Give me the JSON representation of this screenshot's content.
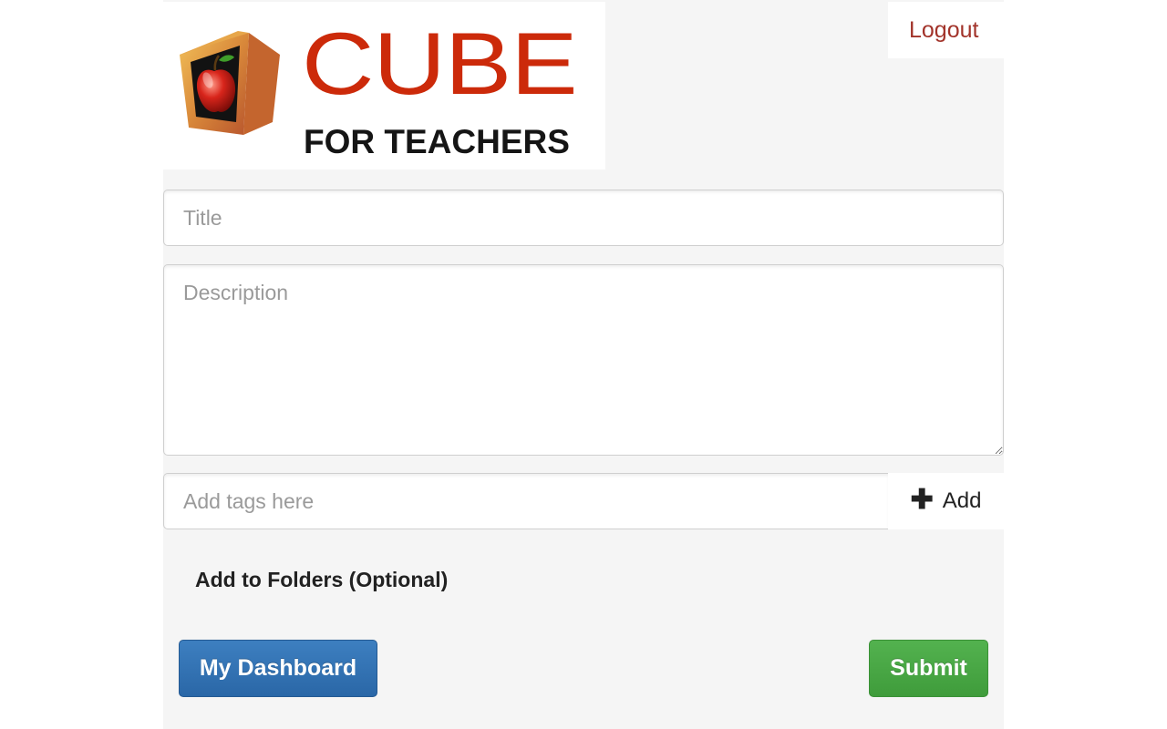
{
  "header": {
    "logo": {
      "word": "CUBE",
      "tagline": "FOR TEACHERS",
      "icon": "apple-cube-icon",
      "word_color": "#cc2a0a"
    },
    "logout_label": "Logout"
  },
  "form": {
    "title_placeholder": "Title",
    "title_value": "",
    "description_placeholder": "Description",
    "description_value": "",
    "tags_placeholder": "Add tags here",
    "tags_value": "",
    "add_label": "Add",
    "add_icon": "plus-icon",
    "folders_label": "Add to Folders (Optional)"
  },
  "actions": {
    "dashboard_label": "My Dashboard",
    "submit_label": "Submit"
  },
  "colors": {
    "dashboard_button": "#2f6fb0",
    "submit_button": "#48a744",
    "logout_link": "#a2332a",
    "panel_background": "#f5f5f5"
  }
}
